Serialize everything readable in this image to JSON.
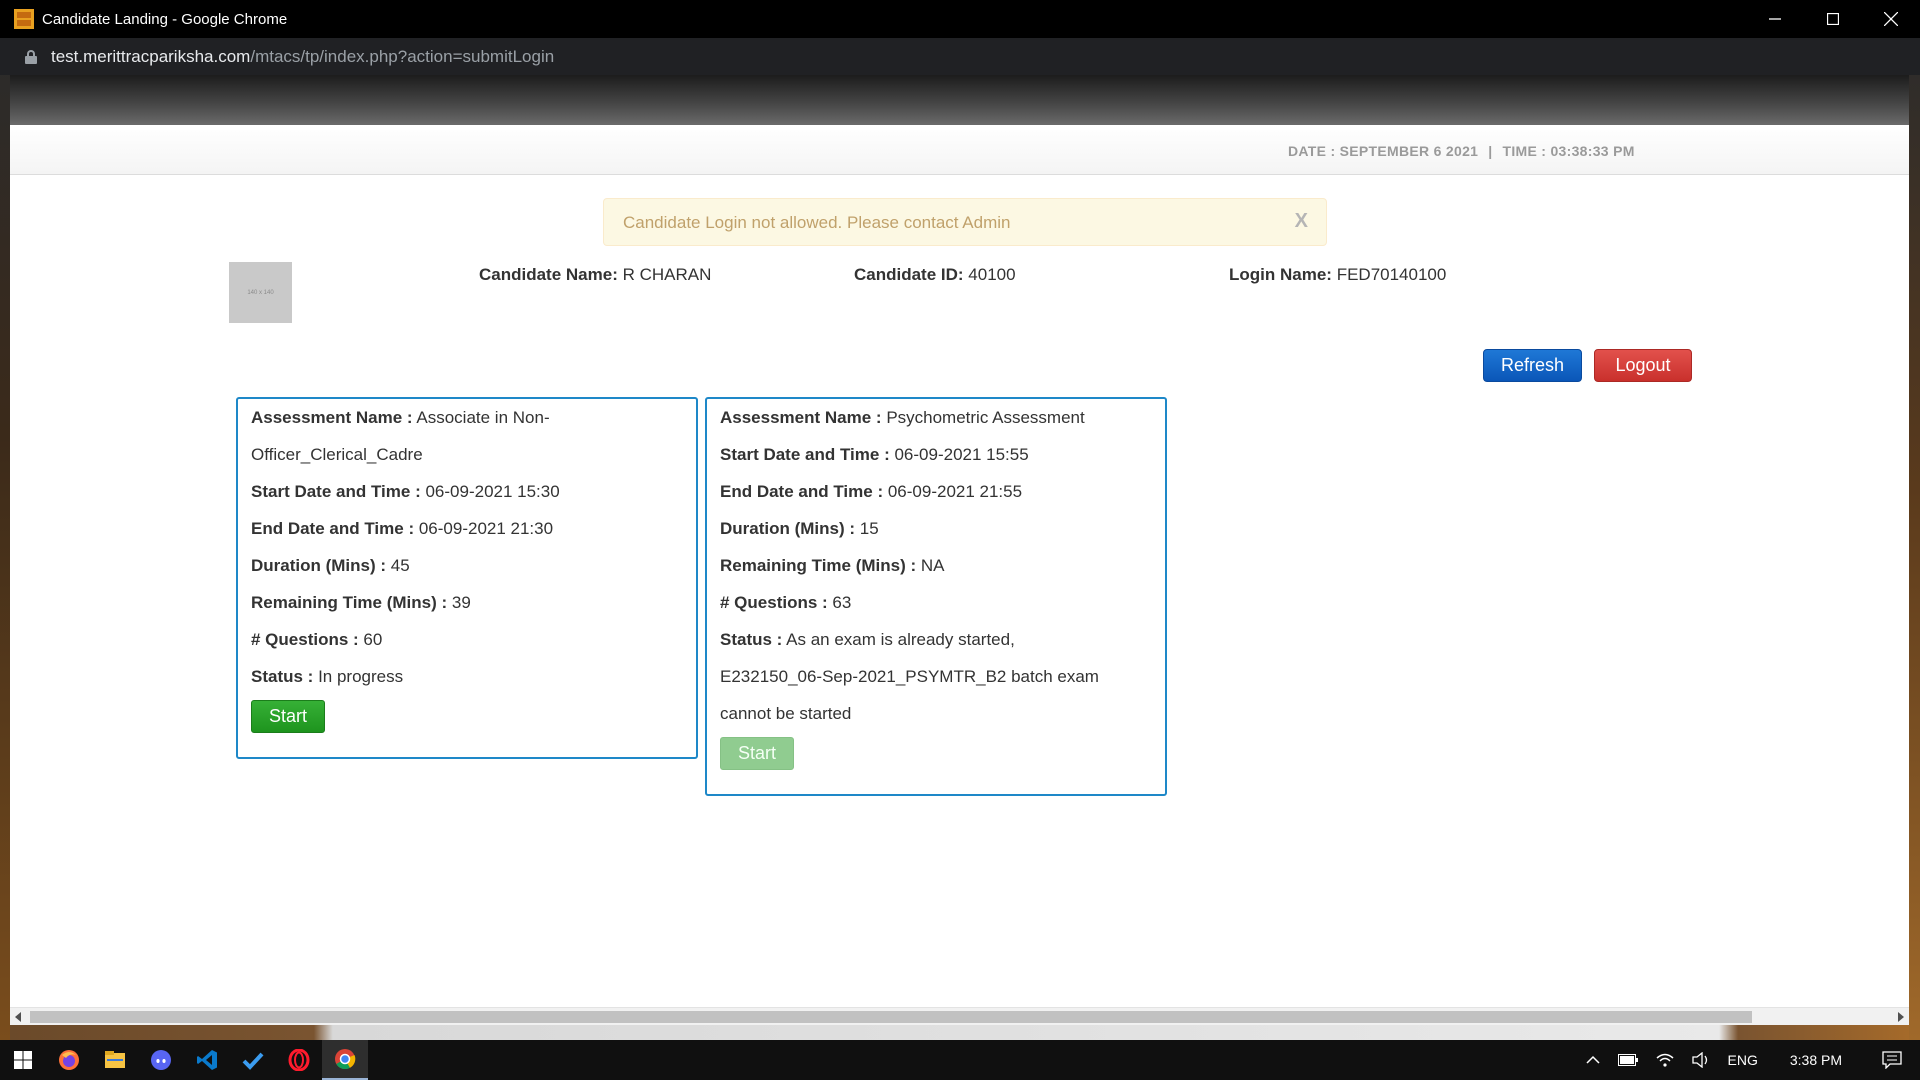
{
  "window": {
    "title": "Candidate Landing - Google Chrome",
    "minimize_label": "—",
    "maximize_label": "☐",
    "close_label": "✕"
  },
  "address_bar": {
    "host": "test.merittracpariksha.com",
    "path": "/mtacs/tp/index.php?action=submitLogin"
  },
  "header": {
    "date": "DATE : SEPTEMBER 6 2021",
    "separator": "|",
    "time": "TIME : 03:38:33 PM"
  },
  "alert": {
    "message": "Candidate Login not allowed. Please contact Admin",
    "close_label": "X"
  },
  "photo": {
    "placeholder": "140 x 140"
  },
  "candidate": {
    "name_label": "Candidate Name:",
    "name_value": "R CHARAN",
    "id_label": "Candidate ID:",
    "id_value": "40100",
    "login_label": "Login Name:",
    "login_value": "FED70140100"
  },
  "actions": {
    "refresh_label": "Refresh",
    "logout_label": "Logout"
  },
  "assessments": [
    {
      "name_label": "Assessment Name :",
      "name_value_line1": "Associate in Non-",
      "name_value_line2": "Officer_Clerical_Cadre",
      "start_label": "Start Date and Time :",
      "start_value": "06-09-2021 15:30",
      "end_label": "End Date and Time :",
      "end_value": "06-09-2021 21:30",
      "duration_label": "Duration (Mins) :",
      "duration_value": "45",
      "remaining_label": "Remaining Time (Mins) :",
      "remaining_value": "39",
      "questions_label": "# Questions :",
      "questions_value": "60",
      "status_label": "Status :",
      "status_value": "In progress",
      "start_button": "Start",
      "start_enabled": true
    },
    {
      "name_label": "Assessment Name :",
      "name_value": "Psychometric Assessment",
      "start_label": "Start Date and Time :",
      "start_value": "06-09-2021 15:55",
      "end_label": "End Date and Time :",
      "end_value": "06-09-2021 21:55",
      "duration_label": "Duration (Mins) :",
      "duration_value": "15",
      "remaining_label": "Remaining Time (Mins) :",
      "remaining_value": "NA",
      "questions_label": "# Questions :",
      "questions_value": "63",
      "status_label": "Status :",
      "status_value_line1": "As an exam is already started,",
      "status_value_line2": "E232150_06-Sep-2021_PSYMTR_B2 batch exam",
      "status_value_line3": "cannot be started",
      "start_button": "Start",
      "start_enabled": false
    }
  ],
  "taskbar": {
    "apps": [
      "windows-start-icon",
      "firefox-icon",
      "file-explorer-icon",
      "discord-icon",
      "vscode-icon",
      "todo-icon",
      "opera-icon",
      "chrome-icon"
    ],
    "language": "ENG",
    "clock": "3:38 PM"
  },
  "colors": {
    "card_border": "#1e88c8",
    "refresh_button": "#0a56b8",
    "logout_button": "#c9302c",
    "start_enabled": "#1e941e",
    "start_disabled": "#90cc90",
    "alert_background": "#fcf8e3",
    "alert_text": "#c0a16b"
  }
}
